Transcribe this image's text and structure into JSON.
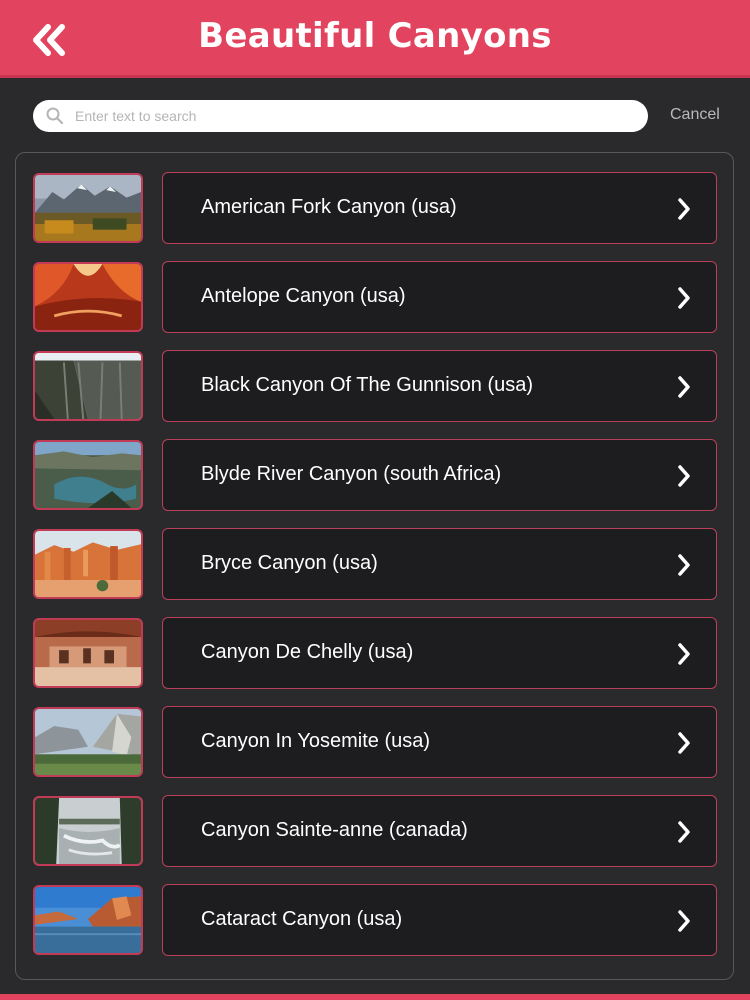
{
  "header": {
    "title": "Beautiful Canyons",
    "back_icon": "double-chevron-left-icon",
    "color": "#e2435f"
  },
  "search": {
    "placeholder": "Enter text to search",
    "value": "",
    "cancel_label": "Cancel"
  },
  "items": [
    {
      "label": "American Fork Canyon (usa)",
      "thumb": "snowy-mountains-autumn"
    },
    {
      "label": "Antelope Canyon (usa)",
      "thumb": "red-slot-canyon"
    },
    {
      "label": "Black Canyon Of The Gunnison (usa)",
      "thumb": "dark-cliffs"
    },
    {
      "label": "Blyde River Canyon (south Africa)",
      "thumb": "river-canyon-green"
    },
    {
      "label": "Bryce Canyon (usa)",
      "thumb": "orange-hoodoos"
    },
    {
      "label": "Canyon De Chelly (usa)",
      "thumb": "cliff-dwelling"
    },
    {
      "label": "Canyon In Yosemite (usa)",
      "thumb": "granite-valley"
    },
    {
      "label": "Canyon Sainte-anne (canada)",
      "thumb": "waterfall-forest"
    },
    {
      "label": "Cataract Canyon (usa)",
      "thumb": "lake-red-cliffs"
    }
  ]
}
